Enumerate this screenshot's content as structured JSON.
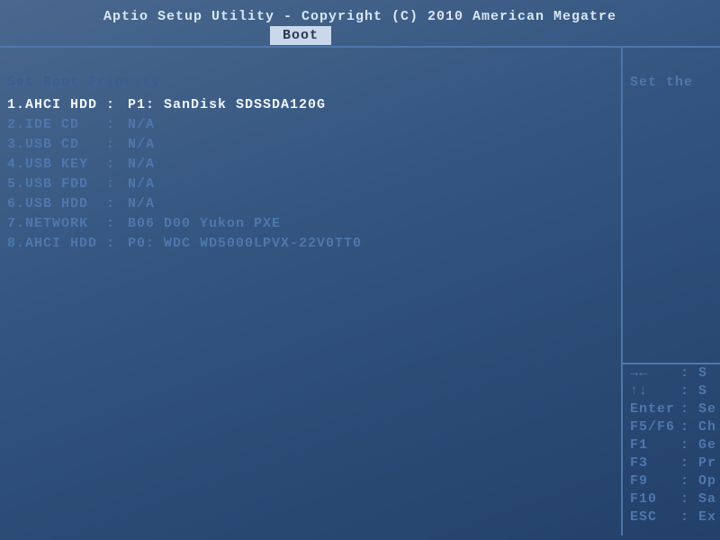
{
  "header": {
    "title": "Aptio Setup Utility - Copyright (C) 2010 American Megatre"
  },
  "tab": {
    "active_label": "Boot"
  },
  "boot": {
    "section_title": "Set Boot Priority",
    "items": [
      {
        "label": "1.AHCI HDD",
        "value": "P1: SanDisk SDSSDA120G",
        "selected": true
      },
      {
        "label": "2.IDE CD",
        "value": "N/A",
        "selected": false
      },
      {
        "label": "3.USB CD",
        "value": "N/A",
        "selected": false
      },
      {
        "label": "4.USB KEY",
        "value": "N/A",
        "selected": false
      },
      {
        "label": "5.USB FDD",
        "value": "N/A",
        "selected": false
      },
      {
        "label": "6.USB HDD",
        "value": "N/A",
        "selected": false
      },
      {
        "label": "7.NETWORK",
        "value": "B06 D00 Yukon PXE",
        "selected": false
      },
      {
        "label": "8.AHCI HDD",
        "value": "P0: WDC WD5000LPVX-22V0TT0",
        "selected": false
      }
    ]
  },
  "help": {
    "text": "Set the"
  },
  "legend": {
    "rows": [
      {
        "key": "→←",
        "sep": ": ",
        "desc": "S"
      },
      {
        "key": "↑↓",
        "sep": ": ",
        "desc": "S"
      },
      {
        "key": "Enter",
        "sep": ": ",
        "desc": "Se"
      },
      {
        "key": "F5/F6",
        "sep": ": ",
        "desc": "Ch"
      },
      {
        "key": "F1",
        "sep": ": ",
        "desc": "Ge"
      },
      {
        "key": "F3",
        "sep": ": ",
        "desc": "Pr"
      },
      {
        "key": "F9",
        "sep": ": ",
        "desc": "Op"
      },
      {
        "key": "F10",
        "sep": ": ",
        "desc": "Sa"
      },
      {
        "key": "ESC",
        "sep": ": ",
        "desc": "Ex"
      }
    ]
  }
}
